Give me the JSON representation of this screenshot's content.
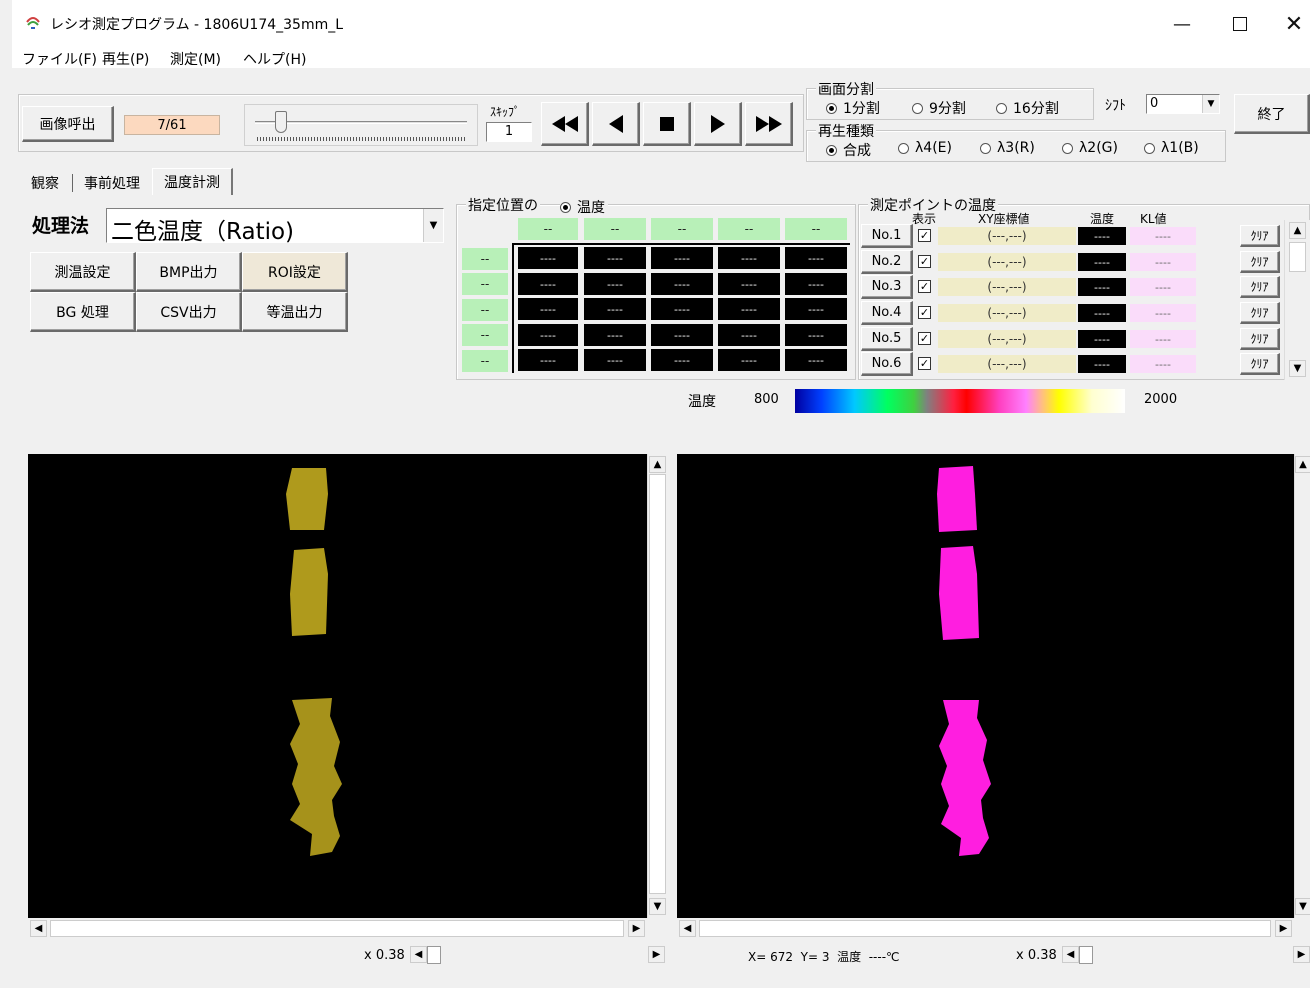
{
  "window": {
    "title": "レシオ測定プログラム - 1806U174_35mm_L"
  },
  "menu": [
    "ファイル(F)",
    "再生(P)",
    "測定(M)",
    "ヘルプ(H)"
  ],
  "toolbar": {
    "load_image": "画像呼出",
    "frame_counter": "7/61",
    "skip_label": "ｽｷｯﾌﾟ",
    "skip_value": "1",
    "exit": "終了"
  },
  "screen_split": {
    "label": "画面分割",
    "options": [
      "1分割",
      "9分割",
      "16分割"
    ],
    "selected": "1分割"
  },
  "shift": {
    "label": "ｼﾌﾄ",
    "value": "0"
  },
  "play_type": {
    "label": "再生種類",
    "options": [
      "合成",
      "λ4(E)",
      "λ3(R)",
      "λ2(G)",
      "λ1(B)"
    ],
    "selected": "合成"
  },
  "tabs": [
    "観察",
    "事前処理",
    "温度計測"
  ],
  "active_tab": "温度計測",
  "method": {
    "label": "処理法",
    "value": "二色温度（Ratio)"
  },
  "actions": [
    "測温設定",
    "BMP出力",
    "ROI設定",
    "BG 処理",
    "CSV出力",
    "等温出力"
  ],
  "designated": {
    "title": "指定位置の",
    "radio": "温度",
    "col_headers": [
      "--",
      "--",
      "--",
      "--",
      "--"
    ],
    "row_headers": [
      "--",
      "--",
      "--",
      "--",
      "--"
    ],
    "cell": "----"
  },
  "points": {
    "title": "測定ポイントの温度",
    "col_show": "表示",
    "col_xy": "XY座標値",
    "col_temp": "温度",
    "col_kl": "KL値",
    "rows": [
      {
        "no": "No.1",
        "xy": "(---,---)",
        "temp": "----",
        "kl": "----",
        "clear": "ｸﾘｱ"
      },
      {
        "no": "No.2",
        "xy": "(---,---)",
        "temp": "----",
        "kl": "----",
        "clear": "ｸﾘｱ"
      },
      {
        "no": "No.3",
        "xy": "(---,---)",
        "temp": "----",
        "kl": "----",
        "clear": "ｸﾘｱ"
      },
      {
        "no": "No.4",
        "xy": "(---,---)",
        "temp": "----",
        "kl": "----",
        "clear": "ｸﾘｱ"
      },
      {
        "no": "No.5",
        "xy": "(---,---)",
        "temp": "----",
        "kl": "----",
        "clear": "ｸﾘｱ"
      },
      {
        "no": "No.6",
        "xy": "(---,---)",
        "temp": "----",
        "kl": "----",
        "clear": "ｸﾘｱ"
      }
    ]
  },
  "scale": {
    "label": "温度",
    "min": "800",
    "max": "2000"
  },
  "left_view": {
    "zoom": "x 0.38"
  },
  "right_view": {
    "status": "X= 672  Y= 3  温度  ----℃",
    "zoom": "x 0.38"
  },
  "colors": {
    "left_blob": "#b8a21e",
    "right_blob": "#ff1ee0",
    "header_green": "#b8f0b8"
  }
}
